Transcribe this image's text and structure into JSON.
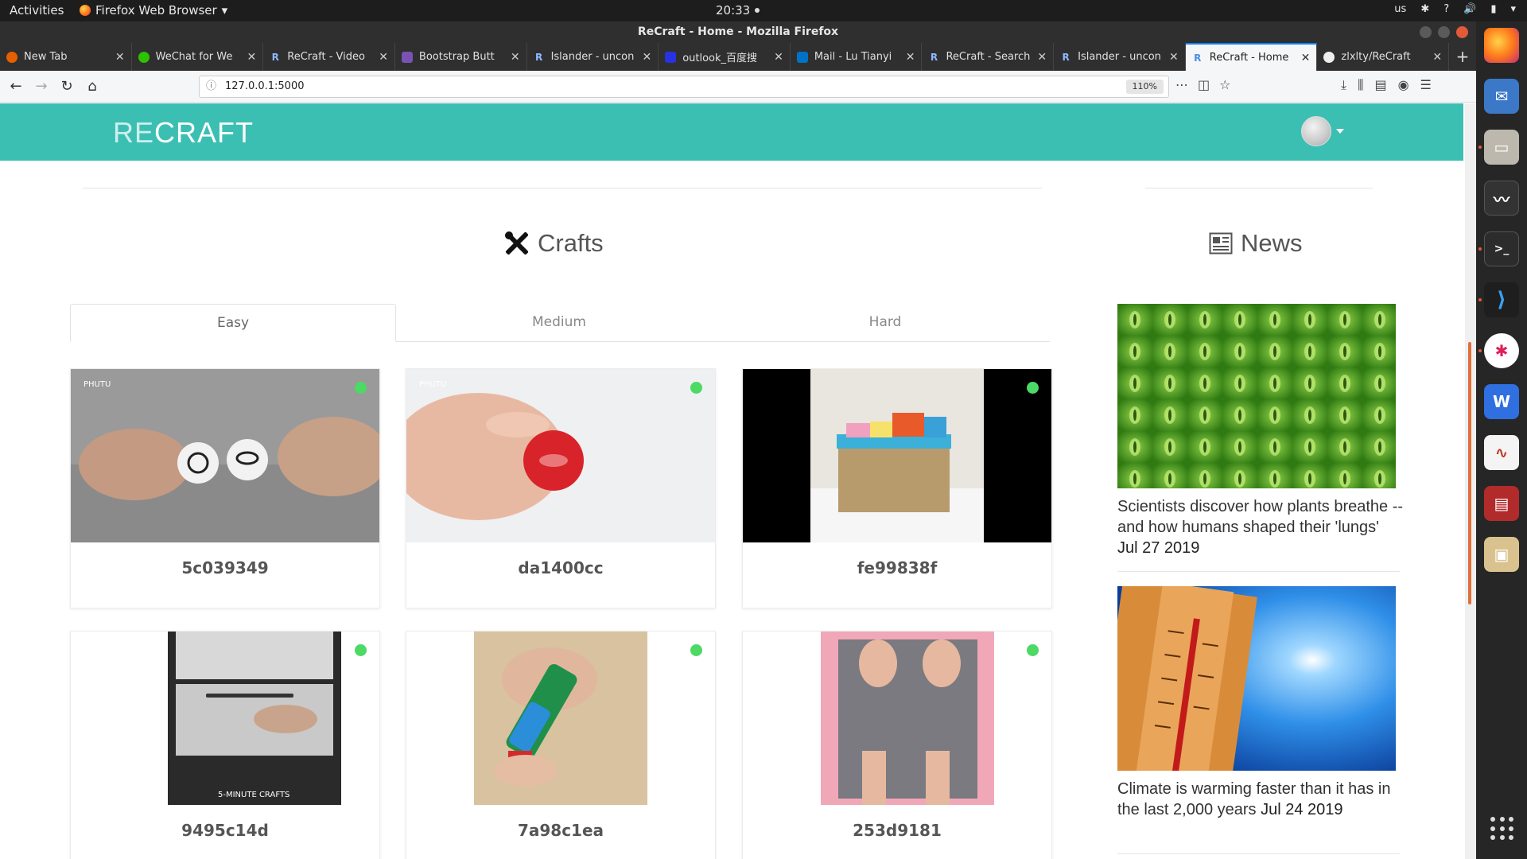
{
  "system_bar": {
    "activities": "Activities",
    "app_name": "Firefox Web Browser",
    "clock": "20:33",
    "keyboard": "us",
    "help": "?"
  },
  "window": {
    "title": "ReCraft - Home - Mozilla Firefox"
  },
  "tabs": [
    {
      "label": "New Tab",
      "favicon": "firefox-icon",
      "favicon_color": "#e66000"
    },
    {
      "label": "WeChat for We",
      "favicon": "wechat-icon",
      "favicon_color": "#2dc100"
    },
    {
      "label": "ReCraft - Video",
      "favicon": "R",
      "favicon_color": "#4a90e2"
    },
    {
      "label": "Bootstrap Butt",
      "favicon": "bootstrap-icon",
      "favicon_color": "#7952b3"
    },
    {
      "label": "Islander - uncon",
      "favicon": "R",
      "favicon_color": "#4a90e2"
    },
    {
      "label": "outlook_百度搜",
      "favicon": "baidu-icon",
      "favicon_color": "#2932e1"
    },
    {
      "label": "Mail - Lu Tianyi",
      "favicon": "outlook-icon",
      "favicon_color": "#0072c6"
    },
    {
      "label": "ReCraft - Search",
      "favicon": "R",
      "favicon_color": "#4a90e2"
    },
    {
      "label": "Islander - uncon",
      "favicon": "R",
      "favicon_color": "#4a90e2"
    },
    {
      "label": "ReCraft - Home",
      "favicon": "R",
      "favicon_color": "#4a90e2",
      "active": true
    },
    {
      "label": "zlxlty/ReCraft",
      "favicon": "github-icon",
      "favicon_color": "#222222"
    }
  ],
  "navbar": {
    "url": "127.0.0.1:5000",
    "zoom": "110%"
  },
  "site": {
    "logo_re": "RE",
    "logo_craft": "CRAFT",
    "brand_color": "#3cbfb3"
  },
  "crafts": {
    "heading": "Crafts",
    "tabs": [
      "Easy",
      "Medium",
      "Hard"
    ],
    "active_tab": "Easy",
    "items": [
      {
        "id": "5c039349"
      },
      {
        "id": "da1400cc"
      },
      {
        "id": "fe99838f"
      },
      {
        "id": "9495c14d"
      },
      {
        "id": "7a98c1ea"
      },
      {
        "id": "253d9181"
      }
    ],
    "status_color": "#4cd964"
  },
  "news": {
    "heading": "News",
    "items": [
      {
        "headline": "Scientists discover how plants breathe -- and how humans shaped their 'lungs'",
        "date": "Jul 27 2019"
      },
      {
        "headline": "Climate is warming faster than it has in the last 2,000 years",
        "date": "Jul 24 2019"
      }
    ]
  }
}
